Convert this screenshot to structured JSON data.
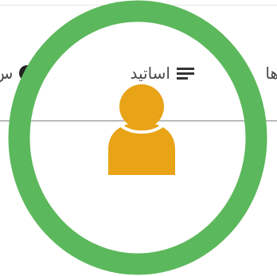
{
  "nav": {
    "teachers_label": "اساتید",
    "left_label": "س",
    "right_label": "ها"
  },
  "icons": {
    "list": "list-icon",
    "help": "help-circle-icon",
    "avatar": "user-avatar-icon"
  },
  "colors": {
    "ring": "#5cb85c",
    "avatar": "#e8a317",
    "text": "#4a4a4a"
  }
}
